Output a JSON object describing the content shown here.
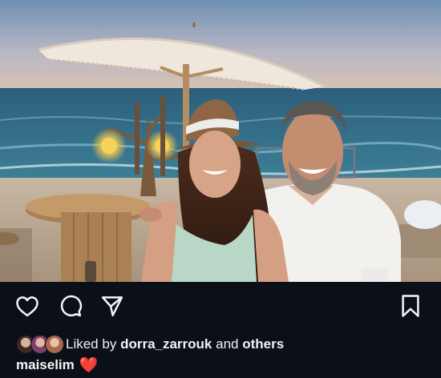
{
  "post": {
    "image_alt": "Couple at beach dinner at sunset",
    "liked_by_prefix": "Liked by",
    "liked_by_user": "dorra_zarrouk",
    "liked_by_and": "and",
    "liked_by_others": "others",
    "caption_user": "maiselim",
    "caption_emoji": "❤️"
  },
  "actions": {
    "like_icon": "heart-outline-icon",
    "comment_icon": "comment-bubble-icon",
    "share_icon": "paper-plane-icon",
    "save_icon": "bookmark-icon"
  },
  "colors": {
    "background": "#0b0f17",
    "text": "#f5f5f5",
    "heart": "#e0243a"
  }
}
